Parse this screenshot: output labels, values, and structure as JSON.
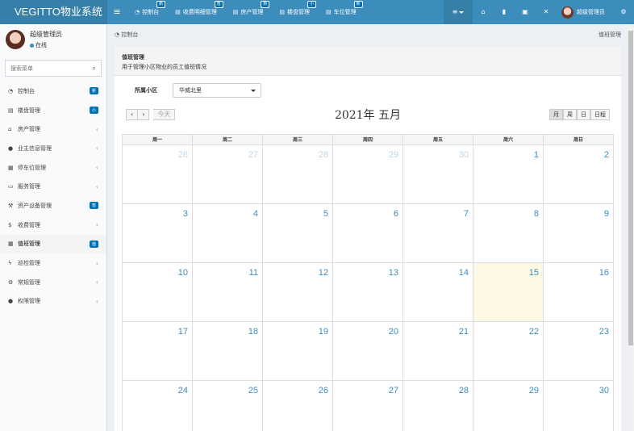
{
  "app": {
    "title": "VEGITTO物业系统"
  },
  "nav": {
    "toggle_icon": "bars-icon",
    "tabs": [
      {
        "label": "控制台",
        "badge": "新"
      },
      {
        "label": "收费明细管理",
        "badge": "暂"
      },
      {
        "label": "房产管理",
        "badge": "新"
      },
      {
        "label": "楼盘管理",
        "badge": "小"
      },
      {
        "label": "车位管理",
        "badge": "新"
      }
    ],
    "user_name": "超级管理员"
  },
  "sidebar": {
    "user_name": "超级管理员",
    "status": "在线",
    "search_placeholder": "搜索菜单",
    "items": [
      {
        "label": "控制台",
        "badge": "新",
        "icon": "dashboard-icon"
      },
      {
        "label": "楼盘管理",
        "badge": "小",
        "icon": "table-icon"
      },
      {
        "label": "房产管理",
        "chevron": "‹",
        "icon": "home-icon"
      },
      {
        "label": "业主信息管理",
        "chevron": "‹",
        "icon": "user-icon"
      },
      {
        "label": "停车位管理",
        "chevron": "‹",
        "icon": "film-icon"
      },
      {
        "label": "服务管理",
        "chevron": "‹",
        "icon": "laptop-icon"
      },
      {
        "label": "资产设备管理",
        "badge": "暂",
        "icon": "gavel-icon"
      },
      {
        "label": "收费管理",
        "chevron": "‹",
        "icon": "dollar-icon"
      },
      {
        "label": "值班管理",
        "badge": "值",
        "icon": "calendar-icon"
      },
      {
        "label": "巡检管理",
        "chevron": "‹",
        "icon": "bolt-icon"
      },
      {
        "label": "常规管理",
        "chevron": "‹",
        "icon": "cogs-icon"
      },
      {
        "label": "权限管理",
        "chevron": "‹",
        "icon": "users-icon"
      }
    ]
  },
  "content": {
    "breadcrumb": "控制台",
    "page_name": "值班管理",
    "panel_title": "值班管理",
    "panel_subtitle": "用于管理小区物业的员工值班情况",
    "filter_label": "所属小区",
    "filter_value": "华威北里",
    "today_label": "今天",
    "calendar_title": "2021年  五月",
    "views": [
      "月",
      "周",
      "日",
      "日程"
    ],
    "weekdays": [
      "周一",
      "周二",
      "周三",
      "周四",
      "周五",
      "周六",
      "周日"
    ],
    "weeks": [
      [
        "26",
        "27",
        "28",
        "29",
        "30",
        "1",
        "2"
      ],
      [
        "3",
        "4",
        "5",
        "6",
        "7",
        "8",
        "9"
      ],
      [
        "10",
        "11",
        "12",
        "13",
        "14",
        "15",
        "16"
      ],
      [
        "17",
        "18",
        "19",
        "20",
        "21",
        "22",
        "23"
      ],
      [
        "24",
        "25",
        "26",
        "27",
        "28",
        "29",
        "30"
      ]
    ],
    "today_date": "15",
    "prev_month_days": [
      "26",
      "27",
      "28",
      "29",
      "30"
    ]
  },
  "colors": {
    "header": "#3c8dbc",
    "logo_bg": "#367fa9",
    "badge": "#0073b7",
    "today": "#fcf8e3"
  }
}
